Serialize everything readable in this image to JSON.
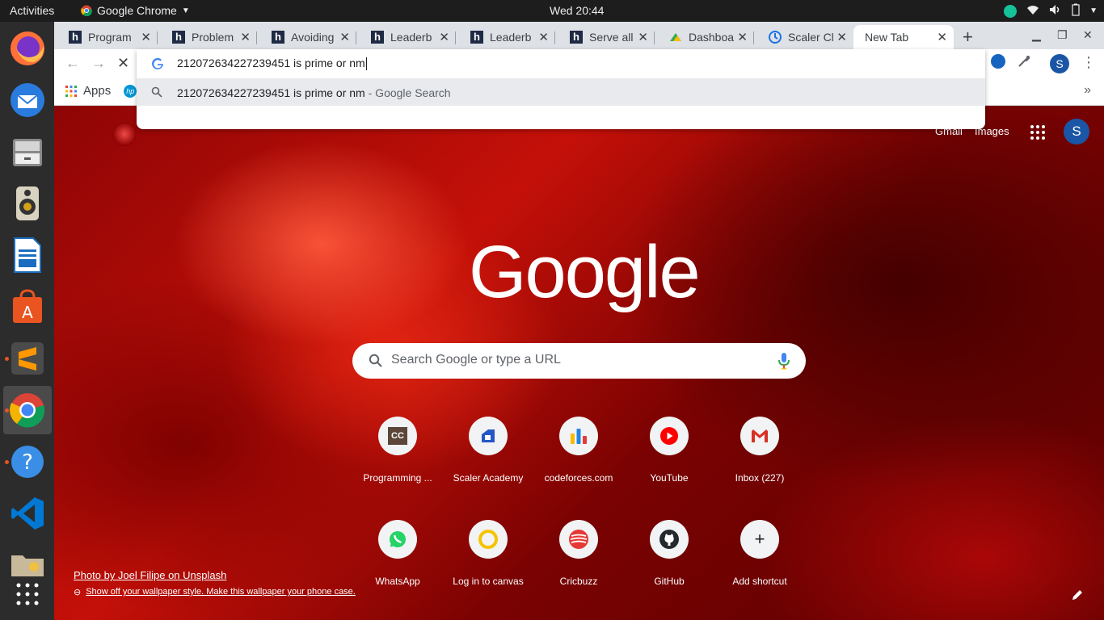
{
  "system": {
    "activities": "Activities",
    "app_name": "Google Chrome",
    "clock": "Wed 20:44"
  },
  "chrome": {
    "tabs": [
      {
        "title": "Program",
        "favicon": "h-icon"
      },
      {
        "title": "Problem",
        "favicon": "h-icon"
      },
      {
        "title": "Avoiding",
        "favicon": "h-icon"
      },
      {
        "title": "Leaderb",
        "favicon": "h-icon"
      },
      {
        "title": "Leaderb",
        "favicon": "h-icon"
      },
      {
        "title": "Serve all",
        "favicon": "h-icon"
      },
      {
        "title": "Dashboa",
        "favicon": "dashboard-icon"
      },
      {
        "title": "Scaler Cl",
        "favicon": "scaler-icon"
      },
      {
        "title": "New Tab",
        "favicon": "none",
        "active": true
      }
    ],
    "omnibox": {
      "typed_text": "212072634227239451 is prime or nm",
      "suggestion_query": "212072634227239451 is prime or nm",
      "suggestion_suffix": " - Google Search"
    },
    "profile_initial": "S",
    "bookmarks": {
      "apps_label": "Apps"
    }
  },
  "ntp": {
    "gmail": "Gmail",
    "images": "Images",
    "avatar": "S",
    "logo": "Google",
    "search_placeholder": "Search Google or type a URL",
    "shortcuts": [
      {
        "label": "Programming ...",
        "icon": "codechef-icon"
      },
      {
        "label": "Scaler Academy",
        "icon": "scaler-academy-icon"
      },
      {
        "label": "codeforces.com",
        "icon": "codeforces-icon"
      },
      {
        "label": "YouTube",
        "icon": "youtube-icon"
      },
      {
        "label": "Inbox (227)",
        "icon": "gmail-icon"
      },
      {
        "label": "WhatsApp",
        "icon": "whatsapp-icon"
      },
      {
        "label": "Log in to canvas",
        "icon": "canvas-icon"
      },
      {
        "label": "Cricbuzz",
        "icon": "cricbuzz-icon"
      },
      {
        "label": "GitHub",
        "icon": "github-icon"
      },
      {
        "label": "Add shortcut",
        "icon": "plus-icon"
      }
    ],
    "photo_credit": "Photo by Joel Filipe on Unsplash",
    "wallpaper_note": "Show off your wallpaper style. Make this wallpaper your phone case."
  },
  "colors": {
    "accent_blue": "#1a73e8",
    "avatar_blue": "#1a56a5",
    "ubuntu_orange": "#e95420"
  }
}
